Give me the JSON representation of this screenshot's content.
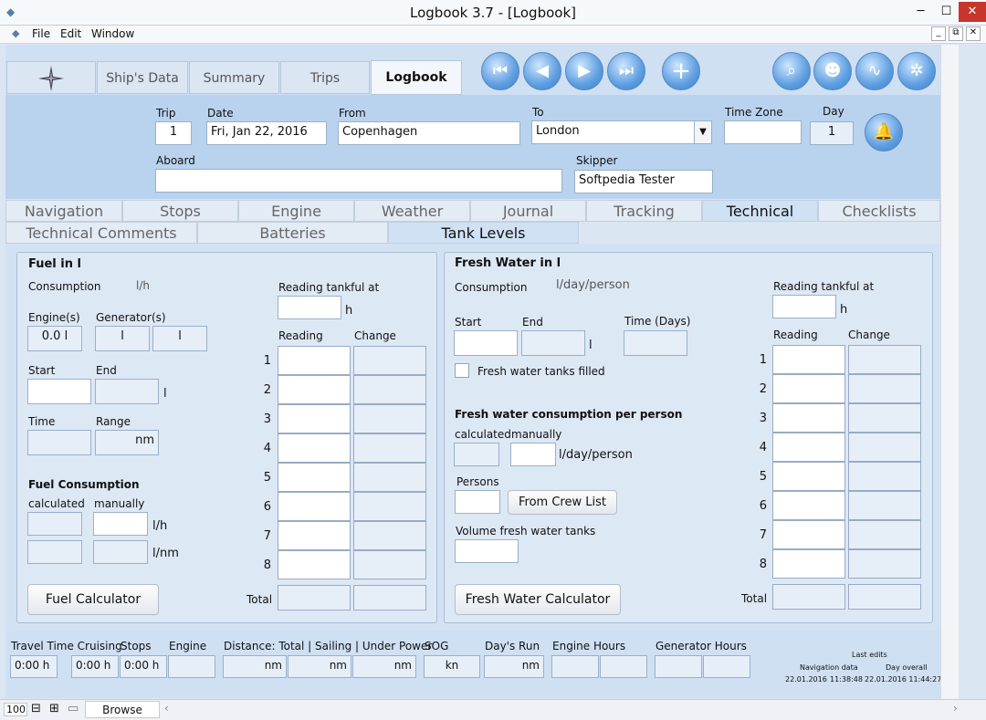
{
  "window": {
    "title": "Logbook 3.7 - [Logbook]",
    "min": "─",
    "max": "☐",
    "close": "✕",
    "doc_min": "_",
    "doc_restore": "⧉",
    "doc_close": "✕"
  },
  "menu": [
    "File",
    "Edit",
    "Window"
  ],
  "tabs": [
    "Ship's Data",
    "Summary",
    "Trips",
    "Logbook"
  ],
  "icons": {
    "compass": "compass-rose",
    "first": "first-record",
    "prev": "previous-record",
    "next": "next-record",
    "last": "last-record",
    "add": "add-record",
    "search": "search",
    "user": "crew",
    "sync": "sync",
    "settings": "gear",
    "bell": "bell"
  },
  "header": {
    "trip_label": "Trip",
    "trip": "1",
    "date_label": "Date",
    "date": "Fri, Jan 22, 2016",
    "from_label": "From",
    "from": "Copenhagen",
    "to_label": "To",
    "to": "London",
    "tz_label": "Time Zone",
    "tz": "",
    "day_label": "Day",
    "day": "1",
    "aboard_label": "Aboard",
    "aboard": "",
    "skipper_label": "Skipper",
    "skipper": "Softpedia Tester"
  },
  "subtabs1": [
    "Navigation",
    "Stops",
    "Engine",
    "Weather",
    "Journal",
    "Tracking",
    "Technical",
    "Checklists"
  ],
  "subtabs2": [
    "Technical Comments",
    "Batteries",
    "Tank Levels"
  ],
  "fuel": {
    "title": "Fuel in l",
    "consumption_label": "Consumption",
    "consumption_unit": "l/h",
    "engines_label": "Engine(s)",
    "engines": "0.0 l",
    "generators_label": "Generator(s)",
    "gen1": "l",
    "gen2": "l",
    "start_label": "Start",
    "end_label": "End",
    "end_unit": "l",
    "time_label": "Time",
    "range_label": "Range",
    "range": "nm",
    "fc_title": "Fuel Consumption",
    "calc_label": "calculated",
    "manual_label": "manually",
    "unit_lh": "l/h",
    "unit_lnm": "l/nm",
    "reading_tankful": "Reading tankful at",
    "unit_h": "h",
    "reading": "Reading",
    "change": "Change",
    "rows": [
      "1",
      "2",
      "3",
      "4",
      "5",
      "6",
      "7",
      "8"
    ],
    "total": "Total",
    "calc_btn": "Fuel Calculator"
  },
  "water": {
    "title": "Fresh Water in l",
    "consumption_label": "Consumption",
    "consumption_unit": "l/day/person",
    "start_label": "Start",
    "end_label": "End",
    "end_unit": "l",
    "time_label": "Time (Days)",
    "filled_label": "Fresh water tanks filled",
    "per_person_title": "Fresh water consumption per person",
    "calc_label": "calculated",
    "manual_label": "manually",
    "unit": "l/day/person",
    "persons_label": "Persons",
    "crew_btn": "From Crew List",
    "volume_label": "Volume fresh water tanks",
    "reading_tankful": "Reading tankful at",
    "unit_h": "h",
    "reading": "Reading",
    "change": "Change",
    "rows": [
      "1",
      "2",
      "3",
      "4",
      "5",
      "6",
      "7",
      "8"
    ],
    "total": "Total",
    "calc_btn": "Fresh Water Calculator"
  },
  "bottom": {
    "travel_label": "Travel Time Cruising",
    "travel": "0:00 h",
    "stops_label": "Stops",
    "stops": "0:00 h",
    "engine_label": "Engine",
    "engine": "0:00 h",
    "distance_label": "Distance: Total | Sailing | Under Power",
    "d1": "nm",
    "d2": "nm",
    "d3": "nm",
    "sog_label": "SOG",
    "sog": "kn",
    "dayrun_label": "Day's Run",
    "dayrun": "nm",
    "ehours_label": "Engine Hours",
    "ghours_label": "Generator Hours",
    "last_edits": "Last edits",
    "nav_data": "Navigation data",
    "day_overall": "Day overall",
    "nav_date": "22.01.2016",
    "nav_time": "11:38:48",
    "day_datetime": "22.01.2016 11:44:27"
  },
  "status": {
    "zoom": "100",
    "mode": "Browse"
  }
}
